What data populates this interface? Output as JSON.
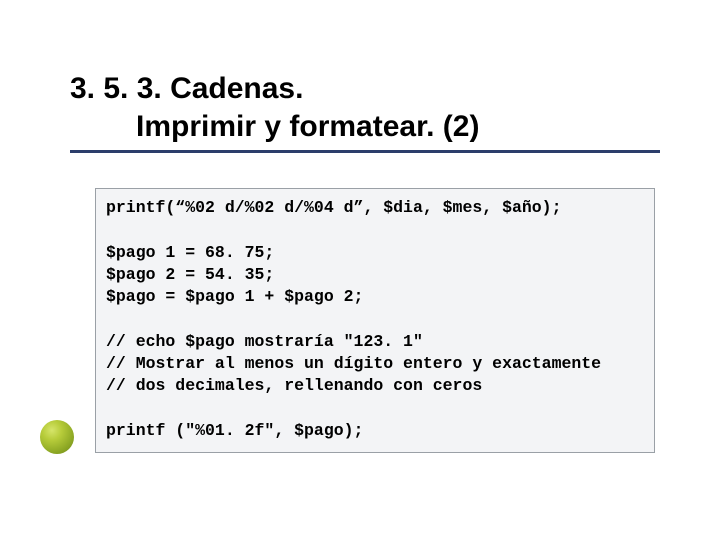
{
  "title": {
    "line1": "3. 5. 3. Cadenas.",
    "line2": "Imprimir y formatear. (2)"
  },
  "code": {
    "line1": "printf(“%02 d/%02 d/%04 d”, $dia, $mes, $año);",
    "blank1": "",
    "line2": "$pago 1 = 68. 75;",
    "line3": "$pago 2 = 54. 35;",
    "line4": "$pago = $pago 1 + $pago 2;",
    "blank2": "",
    "line5": "// echo $pago mostraría \"123. 1\"",
    "line6": "// Mostrar al menos un dígito entero y exactamente",
    "line7": "// dos decimales, rellenando con ceros",
    "blank3": "",
    "line8": "printf (\"%01. 2f\", $pago);"
  }
}
